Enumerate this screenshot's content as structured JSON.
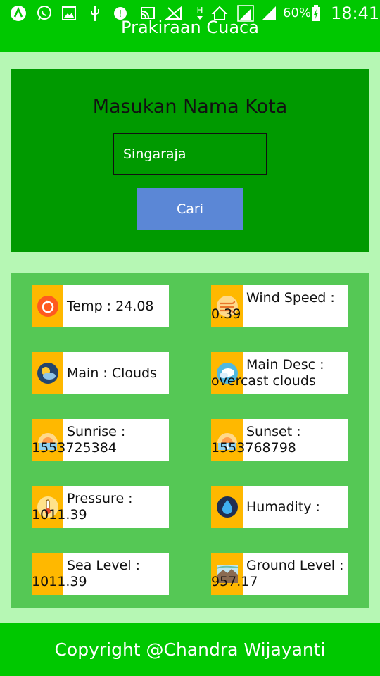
{
  "status_bar": {
    "battery_percent": "60%",
    "time": "18:41",
    "icons": [
      "app-a-icon",
      "whatsapp-icon",
      "image-icon",
      "usb-icon",
      "notification-icon",
      "cast-icon",
      "signal-muted-icon",
      "hplus-icon",
      "home-icon",
      "signal-icon",
      "signal-icon-2",
      "battery-icon"
    ]
  },
  "app_bar": {
    "title": "Prakiraan Cuaca"
  },
  "search": {
    "heading": "Masukan Nama Kota",
    "input_value": "Singaraja",
    "button_label": "Cari"
  },
  "results": {
    "temp": {
      "l1": "Temp : 24.08",
      "icon": "thermometer-icon"
    },
    "wind": {
      "l1": "Wind Speed :",
      "l2": "0.39",
      "icon": "wind-icon"
    },
    "main": {
      "l1": "Main : Clouds",
      "icon": "clouds-icon"
    },
    "main_desc": {
      "l1": "Main Desc :",
      "l2": "overcast clouds",
      "icon": "overcast-icon"
    },
    "sunrise": {
      "l1": "Sunrise :",
      "l2": "1553725384",
      "icon": "sunrise-icon"
    },
    "sunset": {
      "l1": "Sunset :",
      "l2": "1553768798",
      "icon": "sunset-icon"
    },
    "pressure": {
      "l1": "Pressure :",
      "l2": "1011.39",
      "icon": "pressure-icon"
    },
    "humidity": {
      "l1": "Humadity :",
      "icon": "humidity-icon"
    },
    "sea_level": {
      "l1": "Sea Level :",
      "l2": "1011.39",
      "icon": "sea-level-icon"
    },
    "ground_level": {
      "l1": "Ground Level :",
      "l2": "957.17",
      "icon": "ground-level-icon"
    }
  },
  "footer": {
    "text": "Copyright @Chandra Wijayanti"
  },
  "colors": {
    "app_bar": "#00c800",
    "background": "#b6f7b4",
    "search_panel": "#009a00",
    "results_panel": "#55c855",
    "button": "#5b87d6",
    "icon_box": "#ffb800"
  }
}
